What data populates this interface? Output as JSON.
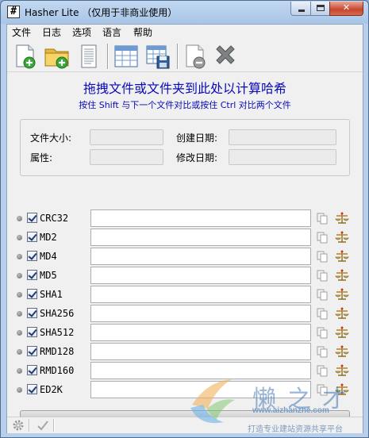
{
  "window": {
    "app_icon": "#",
    "title": "Hasher Lite （仅用于非商业使用）",
    "close_glyph": "✕"
  },
  "menu": [
    "文件",
    "日志",
    "选项",
    "语言",
    "帮助"
  ],
  "toolbar": {
    "icons": [
      "add-file-icon",
      "add-folder-icon",
      "document-icon",
      "table-icon",
      "save-table-icon",
      "remove-file-icon",
      "clear-icon"
    ]
  },
  "drop": {
    "title": "拖拽文件或文件夹到此处以计算哈希",
    "subtitle": "按住 Shift 与下一个文件对比或按住 Ctrl 对比两个文件"
  },
  "info": {
    "file_size_label": "文件大小:",
    "created_label": "创建日期:",
    "attributes_label": "属性:",
    "modified_label": "修改日期:",
    "file_size": "",
    "created": "",
    "attributes": "",
    "modified": ""
  },
  "hashes": [
    {
      "name": "CRC32",
      "checked": true,
      "value": ""
    },
    {
      "name": "MD2",
      "checked": true,
      "value": ""
    },
    {
      "name": "MD4",
      "checked": true,
      "value": ""
    },
    {
      "name": "MD5",
      "checked": true,
      "value": ""
    },
    {
      "name": "SHA1",
      "checked": true,
      "value": ""
    },
    {
      "name": "SHA256",
      "checked": true,
      "value": ""
    },
    {
      "name": "SHA512",
      "checked": true,
      "value": ""
    },
    {
      "name": "RMD128",
      "checked": true,
      "value": ""
    },
    {
      "name": "RMD160",
      "checked": true,
      "value": ""
    },
    {
      "name": "ED2K",
      "checked": true,
      "value": ""
    }
  ],
  "progress": 0,
  "watermark": {
    "title": "懒之才",
    "url": "www.aizhanzhe.com",
    "slogan": "打造专业建站资源共享平台"
  },
  "colors": {
    "accent_text": "#0a0ab8",
    "title_bar": "#b7cfea",
    "close_button": "#c7462f"
  }
}
